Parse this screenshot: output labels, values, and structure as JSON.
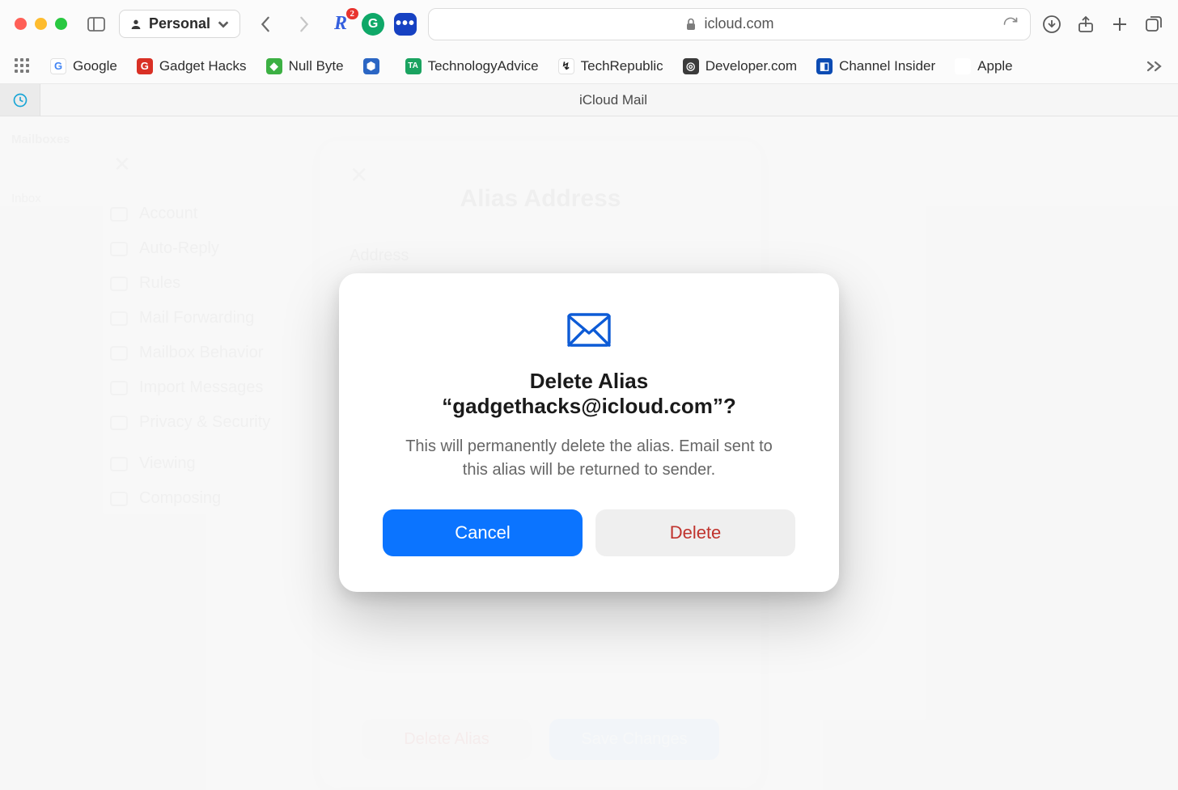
{
  "browser": {
    "profile_label": "Personal",
    "url_host": "icloud.com",
    "ext_badge": "2",
    "bookmarks": [
      {
        "label": "Google",
        "color": "#ffffff",
        "fg": "#4285f4",
        "initial": "G"
      },
      {
        "label": "Gadget Hacks",
        "color": "#d93025",
        "fg": "#ffffff",
        "initial": "G"
      },
      {
        "label": "Null Byte",
        "color": "#3cb043",
        "fg": "#ffffff",
        "initial": "▣"
      },
      {
        "label": "",
        "color": "#2b66c4",
        "fg": "#ffffff",
        "initial": "⬢"
      },
      {
        "label": "TechnologyAdvice",
        "color": "#1aa360",
        "fg": "#ffffff",
        "initial": "TA"
      },
      {
        "label": "TechRepublic",
        "color": "#ffffff",
        "fg": "#222222",
        "initial": "↯"
      },
      {
        "label": "Developer.com",
        "color": "#3b3b3b",
        "fg": "#ffffff",
        "initial": "◎"
      },
      {
        "label": "Channel Insider",
        "color": "#0b4bb3",
        "fg": "#ffffff",
        "initial": "◧"
      },
      {
        "label": "Apple",
        "color": "#ffffff",
        "fg": "#111111",
        "initial": ""
      }
    ],
    "tab_title": "iCloud Mail"
  },
  "ghost": {
    "mailboxes": "Mailboxes",
    "inbox": "Inbox",
    "settings_items": [
      "Account",
      "Auto-Reply",
      "Rules",
      "Mail Forwarding",
      "Mailbox Behavior",
      "Import Messages",
      "Privacy & Security",
      "Viewing",
      "Composing"
    ]
  },
  "alias_panel": {
    "title": "Alias Address",
    "address_label": "Address",
    "delete_btn": "Delete Alias",
    "save_btn": "Save Changes"
  },
  "dialog": {
    "title": "Delete Alias “gadgethacks@icloud.com”?",
    "body": "This will permanently delete the alias. Email sent to this alias will be returned to sender.",
    "cancel": "Cancel",
    "delete": "Delete"
  }
}
